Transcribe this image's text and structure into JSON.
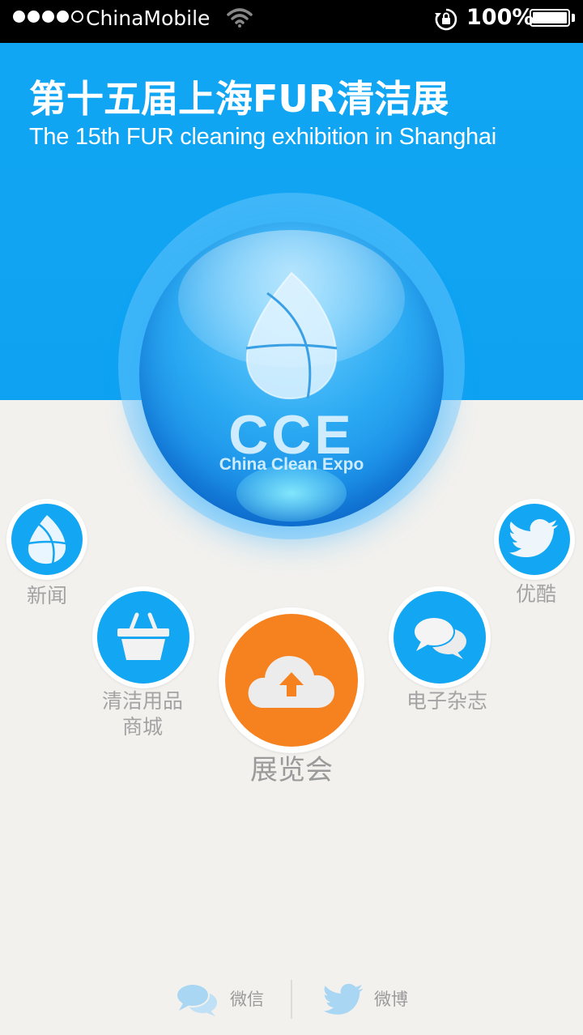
{
  "status_bar": {
    "carrier": "ChinaMobile",
    "signal_bars_filled": 4,
    "signal_bars_total": 5,
    "battery_percent": "100%"
  },
  "header": {
    "title": "第十五届上海FUR清洁展",
    "subtitle": "The 15th FUR cleaning exhibition in Shanghai"
  },
  "logo": {
    "mark": "CCE",
    "tagline": "China Clean Expo"
  },
  "nav": {
    "news": {
      "label": "新闻",
      "icon": "drop-globe-icon"
    },
    "store": {
      "label_line1": "清洁用品",
      "label_line2": "商城",
      "icon": "basket-icon"
    },
    "expo": {
      "label": "展览会",
      "icon": "cloud-upload-icon"
    },
    "magazine": {
      "label": "电子杂志",
      "icon": "chat-bubbles-icon"
    },
    "youku": {
      "label": "优酷",
      "icon": "bird-icon"
    }
  },
  "footer": {
    "wechat_label": "微信",
    "weibo_label": "微博"
  },
  "colors": {
    "brand_blue": "#11a6f3",
    "accent_orange": "#f5821f",
    "background": "#f2f1ee"
  }
}
